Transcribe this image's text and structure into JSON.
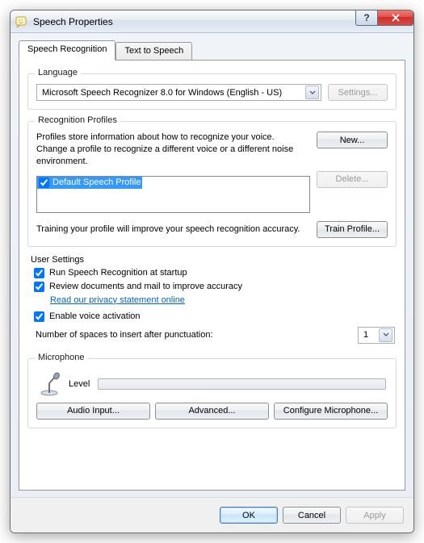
{
  "window": {
    "title": "Speech Properties"
  },
  "tabs": [
    {
      "label": "Speech Recognition",
      "active": true
    },
    {
      "label": "Text to Speech",
      "active": false
    }
  ],
  "language": {
    "legend": "Language",
    "recognizer": "Microsoft Speech Recognizer 8.0 for Windows (English - US)",
    "settings_btn": "Settings..."
  },
  "recognition_profiles": {
    "legend": "Recognition Profiles",
    "description": "Profiles store information about how to recognize your voice.\nChange a profile to recognize a different voice or a different noise environment.",
    "new_btn": "New...",
    "delete_btn": "Delete...",
    "profiles": [
      {
        "label": "Default Speech Profile",
        "checked": true,
        "selected": true
      }
    ],
    "training_text": "Training your profile will improve your speech recognition accuracy.",
    "train_btn": "Train Profile..."
  },
  "user_settings": {
    "legend": "User Settings",
    "run_at_startup": {
      "label": "Run Speech Recognition at startup",
      "checked": true
    },
    "review_docs": {
      "label": "Review documents and mail to improve accuracy",
      "checked": true
    },
    "privacy_link": "Read our privacy statement online",
    "enable_voice": {
      "label": "Enable voice activation",
      "checked": true
    },
    "spaces_label": "Number of spaces to insert after punctuation:",
    "spaces_value": "1"
  },
  "microphone": {
    "legend": "Microphone",
    "level_label": "Level",
    "audio_input_btn": "Audio Input...",
    "advanced_btn": "Advanced...",
    "configure_btn": "Configure Microphone..."
  },
  "footer": {
    "ok": "OK",
    "cancel": "Cancel",
    "apply": "Apply"
  }
}
